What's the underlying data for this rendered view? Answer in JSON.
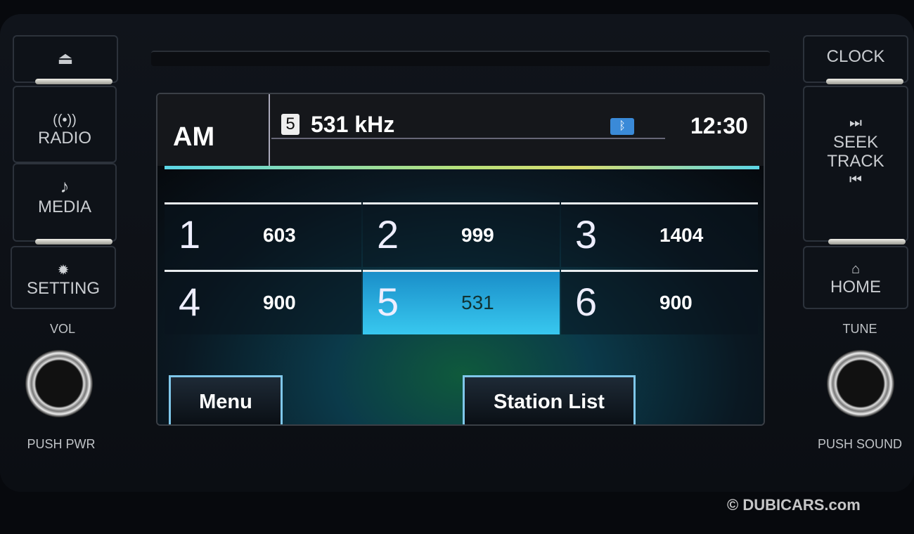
{
  "left_panel": {
    "eject_icon": "eject-icon",
    "radio": "RADIO",
    "media": "MEDIA",
    "setting": "SETTING",
    "vol": "VOL",
    "push_pwr": "PUSH PWR"
  },
  "right_panel": {
    "clock": "CLOCK",
    "seek_track_1": "SEEK",
    "seek_track_2": "TRACK",
    "home": "HOME",
    "tune": "TUNE",
    "push_sound": "PUSH SOUND"
  },
  "screen": {
    "band": "AM",
    "preset_badge": "5",
    "frequency": "531 kHz",
    "bluetooth_icon": "bluetooth-icon",
    "time": "12:30",
    "presets": [
      {
        "num": "1",
        "freq": "603"
      },
      {
        "num": "2",
        "freq": "999"
      },
      {
        "num": "3",
        "freq": "1404"
      },
      {
        "num": "4",
        "freq": "900"
      },
      {
        "num": "5",
        "freq": "531",
        "selected": true
      },
      {
        "num": "6",
        "freq": "900"
      }
    ],
    "menu": "Menu",
    "station_list": "Station List"
  },
  "watermark": "© DUBICARS.com"
}
